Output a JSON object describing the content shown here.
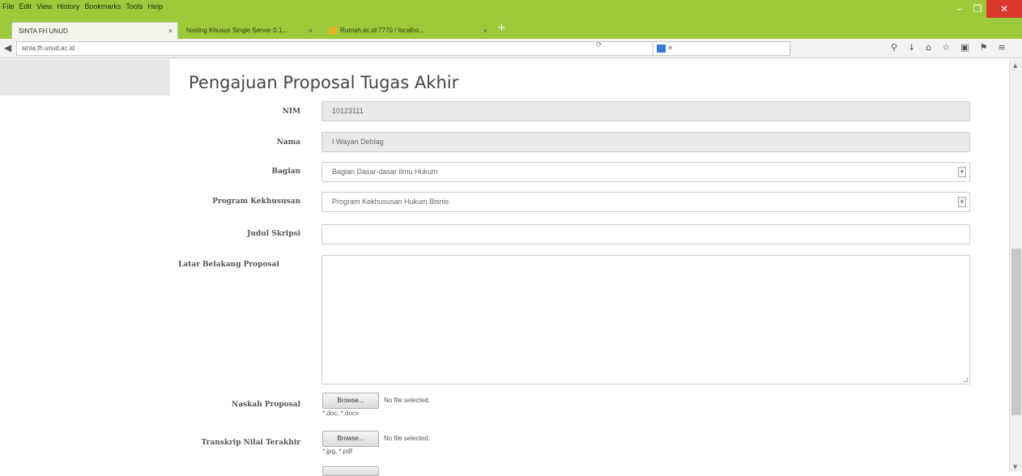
{
  "menu": [
    "File",
    "Edit",
    "View",
    "History",
    "Bookmarks",
    "Tools",
    "Help"
  ],
  "tabs": [
    {
      "title": "SINTA FH UNUD"
    },
    {
      "title": "hosting Khusus Single Server 0.1..."
    },
    {
      "title": "Rumah.ac.id:7770 / localho..."
    }
  ],
  "nav": {
    "url": "sinta.fh.unud.ac.id",
    "search_placeholder": "a"
  },
  "colors": {
    "chrome": "#9cca3a",
    "close": "#d9382b"
  },
  "form": {
    "heading": "Pengajuan Proposal Tugas Akhir",
    "nim_label": "NIM",
    "nim_value": "10123111",
    "nama_label": "Nama",
    "nama_value": "I Wayan Deblag",
    "bagian_label": "Bagian",
    "bagian_value": "Bagian Dasar-dasar Ilmu Hukum",
    "program_label": "Program Kekhususan",
    "program_value": "Program Kekhususan Hukum Bisnis",
    "judul_label": "Judul Skripsi",
    "latar_label": "Latar Belakang Proposal",
    "naskah_label": "Naskah Proposal",
    "naskah_hint": "*.doc, *.docx",
    "transkrip_label": "Transkrip Nilai Terakhir",
    "transkrip_hint": "*.jpg, *.pdf",
    "browse_label": "Browse...",
    "nofile_label": "No file selected."
  }
}
